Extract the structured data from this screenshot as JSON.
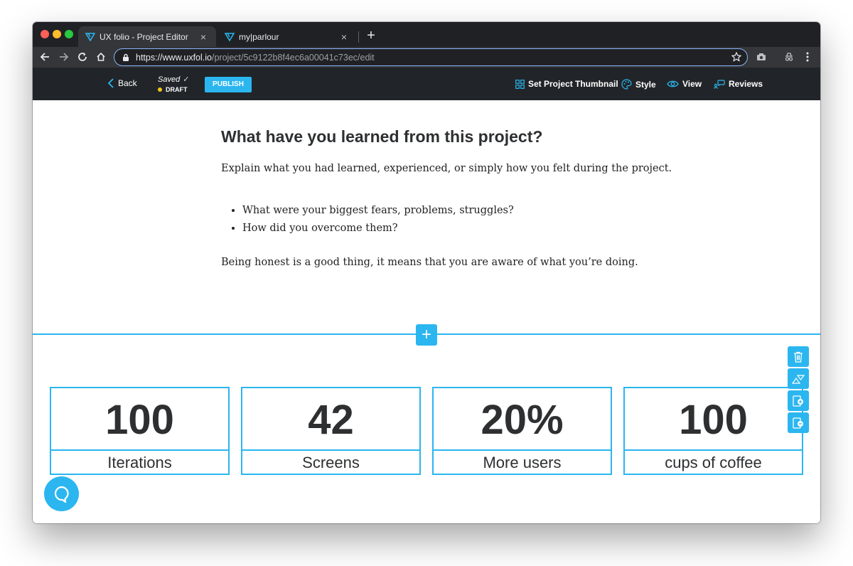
{
  "browser": {
    "tabs": [
      {
        "title": "UX folio - Project Editor",
        "close": "×"
      },
      {
        "title": "my|parlour",
        "close": "×"
      }
    ],
    "new_tab": "+",
    "url_host": "https://www.uxfol.io",
    "url_path": "/project/5c9122b8f4ec6a00041c73ec/edit"
  },
  "editor_bar": {
    "back_label": "Back",
    "saved_label": "Saved",
    "saved_check": "✓",
    "draft_label": "DRAFT",
    "publish_label": "PUBLISH",
    "set_thumbnail_label": "Set Project Thumbnail",
    "style_label": "Style",
    "view_label": "View",
    "reviews_label": "Reviews"
  },
  "content": {
    "heading": "What have you learned from this project?",
    "intro": "Explain what you had learned, experienced, or simply how you felt during the project.",
    "bullets": [
      "What were your biggest fears, problems, struggles?",
      "How did you overcome them?"
    ],
    "closing": "Being honest is a good thing, it means that you are aware of what you’re doing.",
    "add_section": "+"
  },
  "stats": [
    {
      "value": "100",
      "label": "Iterations"
    },
    {
      "value": "42",
      "label": "Screens"
    },
    {
      "value": "20%",
      "label": "More users"
    },
    {
      "value": "100",
      "label": "cups of coffee"
    }
  ],
  "colors": {
    "accent": "#2bb6f0",
    "editor_bar": "#212529",
    "draft_dot": "#f5c518"
  }
}
